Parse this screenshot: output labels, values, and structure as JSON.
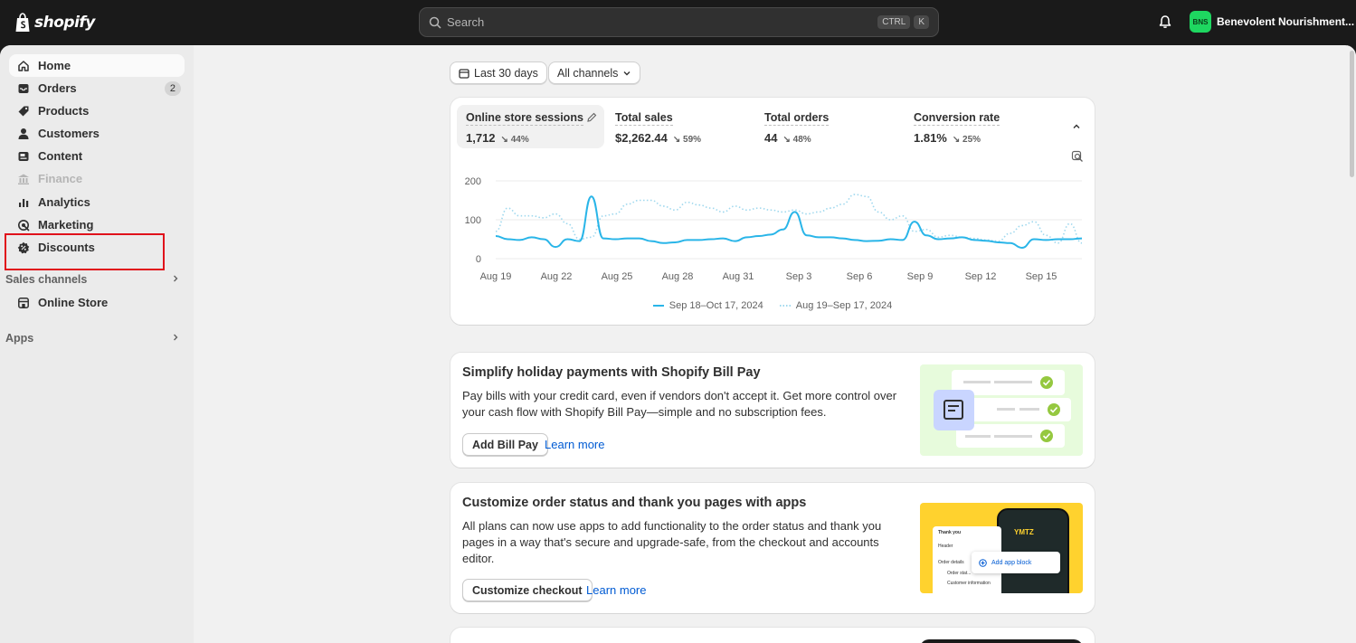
{
  "app": {
    "brand": "shopify"
  },
  "search": {
    "placeholder": "Search",
    "key1": "CTRL",
    "key2": "K"
  },
  "store": {
    "initials": "BNS",
    "name": "Benevolent Nourishment..."
  },
  "sidebar": {
    "items": [
      {
        "label": "Home",
        "icon": "home-icon"
      },
      {
        "label": "Orders",
        "icon": "inbox-icon",
        "badge": "2"
      },
      {
        "label": "Products",
        "icon": "tag-icon"
      },
      {
        "label": "Customers",
        "icon": "person-icon"
      },
      {
        "label": "Content",
        "icon": "content-icon"
      },
      {
        "label": "Finance",
        "icon": "bank-icon"
      },
      {
        "label": "Analytics",
        "icon": "bar-chart-icon"
      },
      {
        "label": "Marketing",
        "icon": "target-icon"
      },
      {
        "label": "Discounts",
        "icon": "discount-icon"
      }
    ],
    "sales_channels_label": "Sales channels",
    "online_store_label": "Online Store",
    "apps_label": "Apps"
  },
  "filters": {
    "date": "Last 30 days",
    "channels": "All channels"
  },
  "metrics": [
    {
      "title": "Online store sessions",
      "value": "1,712",
      "change": "↘ 44%"
    },
    {
      "title": "Total sales",
      "value": "$2,262.44",
      "change": "↘ 59%"
    },
    {
      "title": "Total orders",
      "value": "44",
      "change": "↘ 48%"
    },
    {
      "title": "Conversion rate",
      "value": "1.81%",
      "change": "↘ 25%"
    }
  ],
  "chart_data": {
    "type": "line",
    "x_tick_labels": [
      "Aug 19",
      "Aug 22",
      "Aug 25",
      "Aug 28",
      "Aug 31",
      "Sep 3",
      "Sep 6",
      "Sep 9",
      "Sep 12",
      "Sep 15"
    ],
    "y_tick_labels": [
      "200",
      "100",
      "0"
    ],
    "ylim": [
      0,
      200
    ],
    "grid": true,
    "legend_position": "bottom",
    "series": [
      {
        "name": "Sep 18–Oct 17, 2024",
        "style": "solid",
        "color": "#29b5e8",
        "values": [
          58,
          50,
          48,
          55,
          50,
          30,
          50,
          45,
          160,
          52,
          50,
          52,
          52,
          45,
          40,
          42,
          48,
          48,
          50,
          52,
          45,
          55,
          58,
          62,
          75,
          120,
          60,
          55,
          55,
          52,
          48,
          45,
          46,
          50,
          48,
          95,
          60,
          50,
          52,
          55,
          48,
          46,
          42,
          40,
          28,
          50,
          48,
          50,
          50,
          52
        ]
      },
      {
        "name": "Aug 19–Sep 17, 2024",
        "style": "dotted",
        "color": "#9fd8ee",
        "values": [
          70,
          130,
          110,
          110,
          105,
          115,
          90,
          50,
          55,
          110,
          115,
          140,
          150,
          150,
          135,
          125,
          145,
          138,
          130,
          120,
          135,
          125,
          130,
          125,
          120,
          125,
          115,
          120,
          130,
          140,
          165,
          160,
          120,
          100,
          110,
          70,
          75,
          55,
          60,
          55,
          52,
          48,
          45,
          65,
          85,
          95,
          60,
          40,
          90,
          40
        ]
      }
    ]
  },
  "features": [
    {
      "title": "Simplify holiday payments with Shopify Bill Pay",
      "body": "Pay bills with your credit card, even if vendors don't accept it. Get more control over your cash flow with Shopify Bill Pay—simple and no subscription fees.",
      "button": "Add Bill Pay",
      "link": "Learn more"
    },
    {
      "title": "Customize order status and thank you pages with apps",
      "body": "All plans can now use apps to add functionality to the order status and thank you pages in a way that's secure and upgrade-safe, from the checkout and accounts editor.",
      "button": "Customize checkout",
      "link": "Learn more",
      "illustration": {
        "heading": "Thank you",
        "header": "Header",
        "order_details": "Order details",
        "order_status": "Order stat...",
        "customer_info": "Customer information",
        "add_block": "Add app block",
        "brand": "YMTZ"
      }
    }
  ],
  "colors": {
    "accent": "#005bd3",
    "topbar": "#1a1a1a",
    "highlight": "#e0121b",
    "store_avatar": "#1ed760"
  }
}
